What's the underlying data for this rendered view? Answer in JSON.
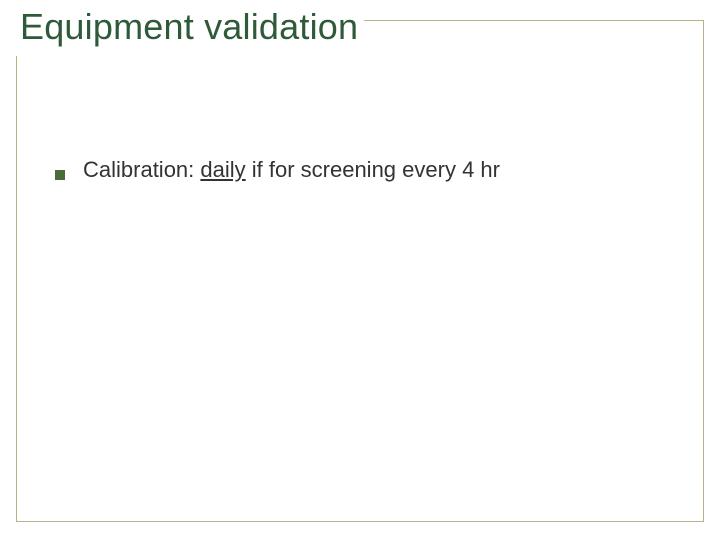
{
  "title": "Equipment validation",
  "bullets": [
    {
      "label": "Calibration: ",
      "underlined": "daily",
      "rest": " if for screening every 4 hr"
    }
  ]
}
